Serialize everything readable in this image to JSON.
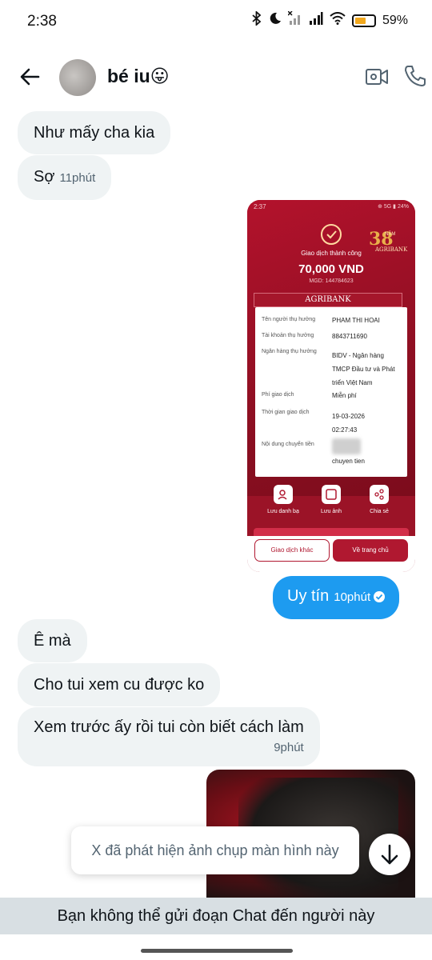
{
  "status_bar": {
    "time": "2:38",
    "battery_percent": "59%",
    "battery_level": 0.59,
    "battery_color": "#f2a81d"
  },
  "header": {
    "contact_name": "bé iu😛"
  },
  "messages": [
    {
      "text": "Như mấy cha kia",
      "side": "left"
    },
    {
      "text": "Sợ",
      "time": "11phút",
      "side": "left"
    },
    {
      "text": "Uy tín",
      "time": "10phút",
      "side": "right"
    },
    {
      "text": "Ê mà",
      "side": "left"
    },
    {
      "text": "Cho tui xem cu được ko",
      "side": "left"
    },
    {
      "text": "Xem trước ấy rồi tui còn biết cách làm",
      "time": "9phút",
      "side": "left"
    }
  ],
  "receipt": {
    "status_time": "2:37",
    "status_icons": "⊕ 5G ▮ 24%",
    "years": "38",
    "years_sub": "NĂM",
    "bank_small": "AGRIBANK",
    "title": "Giao dịch thành công",
    "amount": "70,000 VND",
    "mgd": "MGD: 144784623",
    "brand": "AGRIBANK",
    "rows": [
      {
        "label": "Tên người thụ hưởng",
        "value": "PHAM THI HOAI"
      },
      {
        "label": "Tài khoản thụ hưởng",
        "value": "8843711690"
      },
      {
        "label": "Ngân hàng thụ hưởng",
        "value": "BIDV - Ngân hàng TMCP Đầu tư và Phát triển Việt Nam"
      },
      {
        "label": "Phí giao dịch",
        "value": "Miễn phí"
      },
      {
        "label": "Thời gian giao dịch",
        "value": "19-03-2026 02:27:43"
      },
      {
        "label": "Nội dung chuyển tiền",
        "value": "chuyen tien"
      }
    ],
    "actions": [
      "Lưu danh bạ",
      "Lưu ảnh",
      "Chia sẻ"
    ],
    "btn_other": "Giao dịch khác",
    "btn_home": "Về trang chủ",
    "brand_color": "#b01830"
  },
  "toast": {
    "text": "X đã phát hiện ảnh chụp màn hình này"
  },
  "footer": {
    "notice": "Bạn không thể gửi đoạn Chat đến người này"
  },
  "colors": {
    "accent": "#1d9bf0",
    "bubble_left": "#eff3f4",
    "text": "#0f1419",
    "muted": "#536471"
  }
}
